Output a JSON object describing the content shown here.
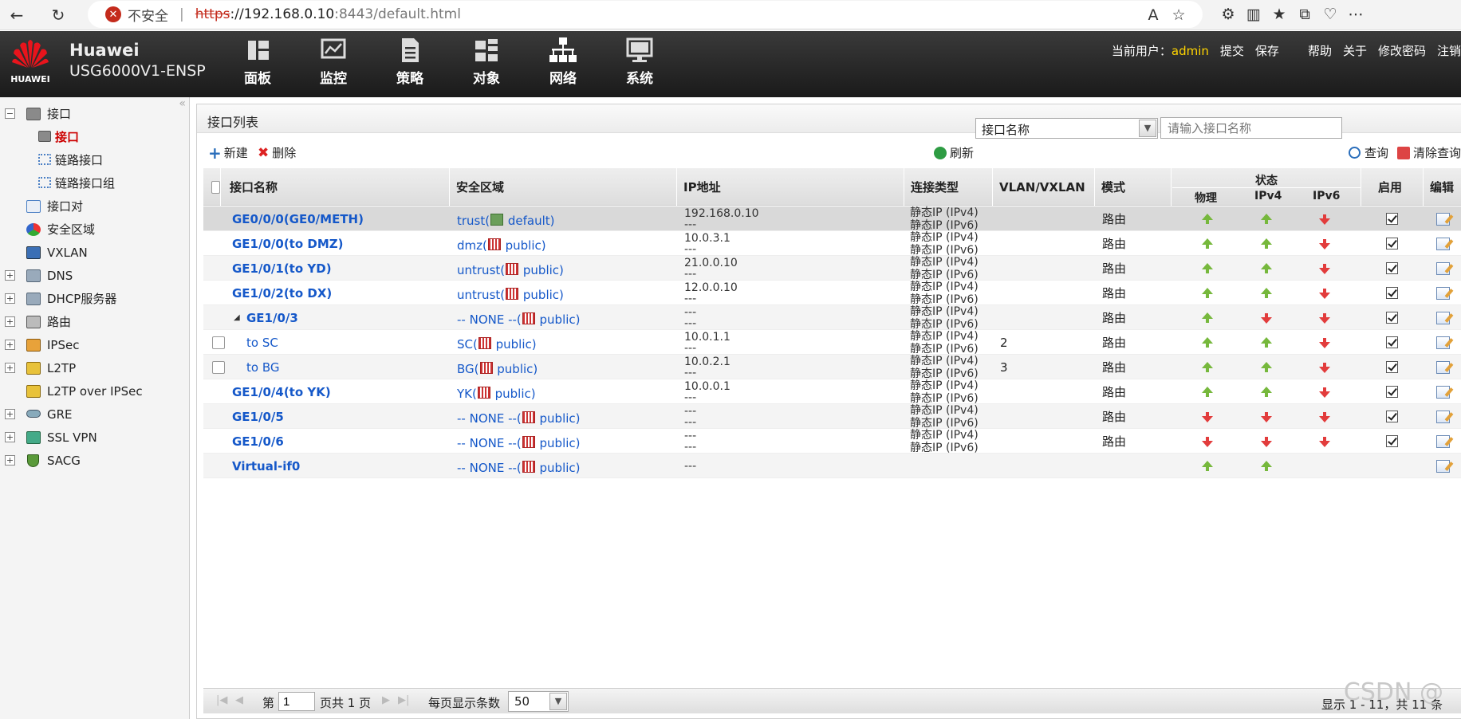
{
  "browser": {
    "insecure_label": "不安全",
    "url_scheme": "https",
    "url_host": "://192.168.0.10",
    "url_port": ":8443",
    "url_path": "/default.html"
  },
  "header": {
    "logo_text": "HUAWEI",
    "brand": "Huawei",
    "model": "USG6000V1-ENSP",
    "nav": [
      "面板",
      "监控",
      "策略",
      "对象",
      "网络",
      "系统"
    ],
    "current_user_label": "当前用户：",
    "user": "admin",
    "actions": [
      "提交",
      "保存",
      "帮助",
      "关于",
      "修改密码",
      "注销"
    ]
  },
  "sidebar": {
    "items": [
      {
        "label": "接口"
      },
      {
        "label": "接口"
      },
      {
        "label": "链路接口"
      },
      {
        "label": "链路接口组"
      },
      {
        "label": "接口对"
      },
      {
        "label": "安全区域"
      },
      {
        "label": "VXLAN"
      },
      {
        "label": "DNS"
      },
      {
        "label": "DHCP服务器"
      },
      {
        "label": "路由"
      },
      {
        "label": "IPSec"
      },
      {
        "label": "L2TP"
      },
      {
        "label": "L2TP over IPSec"
      },
      {
        "label": "GRE"
      },
      {
        "label": "SSL VPN"
      },
      {
        "label": "SACG"
      }
    ]
  },
  "main": {
    "title": "接口列表",
    "new_label": "新建",
    "delete_label": "删除",
    "refresh_label": "刷新",
    "filter_select": "接口名称",
    "search_placeholder": "请输入接口名称",
    "query_label": "查询",
    "clear_label": "清除查询"
  },
  "table": {
    "headers": {
      "name": "接口名称",
      "zone": "安全区域",
      "ip": "IP地址",
      "conn": "连接类型",
      "vlan": "VLAN/VXLAN",
      "mode": "模式",
      "status": "状态",
      "phys": "物理",
      "ipv4": "IPv4",
      "ipv6": "IPv6",
      "enable": "启用",
      "edit": "编辑"
    },
    "rows": [
      {
        "name": "GE0/0/0(GE0/METH)",
        "zone": "trust(",
        "vsys": " default)",
        "ip1": "192.168.0.10",
        "ip2": "---",
        "c1": "静态IP (IPv4)",
        "c2": "静态IP (IPv6)",
        "vlan": "",
        "mode": "路由",
        "phys": "up",
        "v4": "up",
        "v6": "down",
        "enabled": true
      },
      {
        "name": "GE1/0/0(to DMZ)",
        "zone": "dmz(",
        "vsys": " public)",
        "ip1": "10.0.3.1",
        "ip2": "---",
        "c1": "静态IP (IPv4)",
        "c2": "静态IP (IPv6)",
        "vlan": "",
        "mode": "路由",
        "phys": "up",
        "v4": "up",
        "v6": "down",
        "enabled": true
      },
      {
        "name": "GE1/0/1(to YD)",
        "zone": "untrust(",
        "vsys": " public)",
        "ip1": "21.0.0.10",
        "ip2": "---",
        "c1": "静态IP (IPv4)",
        "c2": "静态IP (IPv6)",
        "vlan": "",
        "mode": "路由",
        "phys": "up",
        "v4": "up",
        "v6": "down",
        "enabled": true
      },
      {
        "name": "GE1/0/2(to DX)",
        "zone": "untrust(",
        "vsys": " public)",
        "ip1": "12.0.0.10",
        "ip2": "---",
        "c1": "静态IP (IPv4)",
        "c2": "静态IP (IPv6)",
        "vlan": "",
        "mode": "路由",
        "phys": "up",
        "v4": "up",
        "v6": "down",
        "enabled": true
      },
      {
        "name": "GE1/0/3",
        "zone": "-- NONE --(",
        "vsys": " public)",
        "ip1": "---",
        "ip2": "---",
        "c1": "静态IP (IPv4)",
        "c2": "静态IP (IPv6)",
        "vlan": "",
        "mode": "路由",
        "phys": "up",
        "v4": "down",
        "v6": "down",
        "enabled": true
      },
      {
        "name": "to SC",
        "zone": "SC(",
        "vsys": " public)",
        "ip1": "10.0.1.1",
        "ip2": "---",
        "c1": "静态IP (IPv4)",
        "c2": "静态IP (IPv6)",
        "vlan": "2",
        "mode": "路由",
        "phys": "up",
        "v4": "up",
        "v6": "down",
        "enabled": true
      },
      {
        "name": "to BG",
        "zone": "BG(",
        "vsys": " public)",
        "ip1": "10.0.2.1",
        "ip2": "---",
        "c1": "静态IP (IPv4)",
        "c2": "静态IP (IPv6)",
        "vlan": "3",
        "mode": "路由",
        "phys": "up",
        "v4": "up",
        "v6": "down",
        "enabled": true
      },
      {
        "name": "GE1/0/4(to YK)",
        "zone": "YK(",
        "vsys": " public)",
        "ip1": "10.0.0.1",
        "ip2": "---",
        "c1": "静态IP (IPv4)",
        "c2": "静态IP (IPv6)",
        "vlan": "",
        "mode": "路由",
        "phys": "up",
        "v4": "up",
        "v6": "down",
        "enabled": true
      },
      {
        "name": "GE1/0/5",
        "zone": "-- NONE --(",
        "vsys": " public)",
        "ip1": "---",
        "ip2": "---",
        "c1": "静态IP (IPv4)",
        "c2": "静态IP (IPv6)",
        "vlan": "",
        "mode": "路由",
        "phys": "down",
        "v4": "down",
        "v6": "down",
        "enabled": true
      },
      {
        "name": "GE1/0/6",
        "zone": "-- NONE --(",
        "vsys": " public)",
        "ip1": "---",
        "ip2": "---",
        "c1": "静态IP (IPv4)",
        "c2": "静态IP (IPv6)",
        "vlan": "",
        "mode": "路由",
        "phys": "down",
        "v4": "down",
        "v6": "down",
        "enabled": true
      },
      {
        "name": "Virtual-if0",
        "zone": "-- NONE --(",
        "vsys": " public)",
        "ip1": "---",
        "ip2": "",
        "c1": "",
        "c2": "",
        "vlan": "",
        "mode": "",
        "phys": "up",
        "v4": "up",
        "v6": "",
        "enabled": false
      }
    ]
  },
  "footer": {
    "page_prefix": "第",
    "page_value": "1",
    "page_suffix": "页共 1 页",
    "per_page_label": "每页显示条数",
    "per_page": "50",
    "summary": "显示 1 - 11，共 11 条"
  },
  "watermark": "CSDN @"
}
